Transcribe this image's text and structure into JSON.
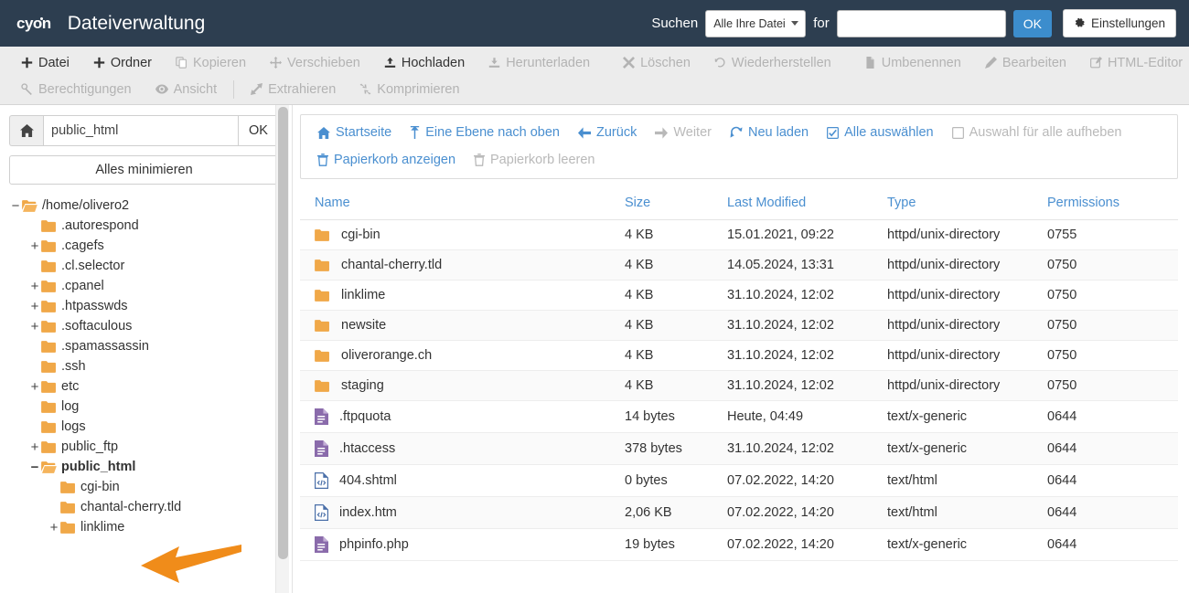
{
  "header": {
    "logo": "cyon",
    "title": "Dateiverwaltung",
    "search_label": "Suchen",
    "search_scope": "Alle Ihre Dateien",
    "for_label": "for",
    "search_value": "",
    "search_placeholder": "",
    "ok_label": "OK",
    "settings_label": "Einstellungen",
    "bg_color": "#2d3e50",
    "accent_color": "#3c8dcd"
  },
  "toolbar": {
    "row1": [
      {
        "label": "Datei",
        "icon": "plus-icon",
        "disabled": false
      },
      {
        "label": "Ordner",
        "icon": "plus-icon",
        "disabled": false
      },
      {
        "label": "Kopieren",
        "icon": "copy-icon",
        "disabled": true
      },
      {
        "label": "Verschieben",
        "icon": "move-icon",
        "disabled": true
      },
      {
        "label": "Hochladen",
        "icon": "upload-icon",
        "disabled": false
      },
      {
        "label": "Herunterladen",
        "icon": "download-icon",
        "disabled": true
      },
      {
        "label": "Löschen",
        "icon": "close-icon",
        "disabled": true
      },
      {
        "label": "Wiederherstellen",
        "icon": "undo-icon",
        "disabled": true
      },
      {
        "label": "Umbenennen",
        "icon": "file-icon",
        "disabled": true
      },
      {
        "label": "Bearbeiten",
        "icon": "pencil-icon",
        "disabled": true
      },
      {
        "label": "HTML-Editor",
        "icon": "html-edit-icon",
        "disabled": true
      }
    ],
    "row2": [
      {
        "label": "Berechtigungen",
        "icon": "key-icon",
        "disabled": true
      },
      {
        "label": "Ansicht",
        "icon": "eye-icon",
        "disabled": true
      },
      {
        "label": "Extrahieren",
        "icon": "expand-icon",
        "disabled": true
      },
      {
        "label": "Komprimieren",
        "icon": "compress-icon",
        "disabled": true
      }
    ]
  },
  "sidebar": {
    "home_icon": "home-icon",
    "path_value": "public_html",
    "path_ok_label": "OK",
    "collapse_all_label": "Alles minimieren",
    "tree": [
      {
        "label": "/home/olivero2",
        "indent": 0,
        "toggle": "−",
        "icon": "folder-open-icon",
        "bold": false
      },
      {
        "label": ".autorespond",
        "indent": 1,
        "toggle": "",
        "icon": "folder-icon",
        "bold": false
      },
      {
        "label": ".cagefs",
        "indent": 1,
        "toggle": "+",
        "icon": "folder-icon",
        "bold": false
      },
      {
        "label": ".cl.selector",
        "indent": 1,
        "toggle": "",
        "icon": "folder-icon",
        "bold": false
      },
      {
        "label": ".cpanel",
        "indent": 1,
        "toggle": "+",
        "icon": "folder-icon",
        "bold": false
      },
      {
        "label": ".htpasswds",
        "indent": 1,
        "toggle": "+",
        "icon": "folder-icon",
        "bold": false
      },
      {
        "label": ".softaculous",
        "indent": 1,
        "toggle": "+",
        "icon": "folder-icon",
        "bold": false
      },
      {
        "label": ".spamassassin",
        "indent": 1,
        "toggle": "",
        "icon": "folder-icon",
        "bold": false
      },
      {
        "label": ".ssh",
        "indent": 1,
        "toggle": "",
        "icon": "folder-icon",
        "bold": false
      },
      {
        "label": "etc",
        "indent": 1,
        "toggle": "+",
        "icon": "folder-icon",
        "bold": false
      },
      {
        "label": "log",
        "indent": 1,
        "toggle": "",
        "icon": "folder-icon",
        "bold": false
      },
      {
        "label": "logs",
        "indent": 1,
        "toggle": "",
        "icon": "folder-icon",
        "bold": false
      },
      {
        "label": "public_ftp",
        "indent": 1,
        "toggle": "+",
        "icon": "folder-icon",
        "bold": false
      },
      {
        "label": "public_html",
        "indent": 1,
        "toggle": "−",
        "icon": "folder-open-icon",
        "bold": true
      },
      {
        "label": "cgi-bin",
        "indent": 2,
        "toggle": "",
        "icon": "folder-icon",
        "bold": false
      },
      {
        "label": "chantal-cherry.tld",
        "indent": 2,
        "toggle": "",
        "icon": "folder-icon",
        "bold": false
      },
      {
        "label": "linklime",
        "indent": 2,
        "toggle": "+",
        "icon": "folder-icon",
        "bold": false
      }
    ]
  },
  "nav": {
    "row1": [
      {
        "label": "Startseite",
        "icon": "home-icon",
        "disabled": false
      },
      {
        "label": "Eine Ebene nach oben",
        "icon": "arrow-up-icon",
        "disabled": false
      },
      {
        "label": "Zurück",
        "icon": "arrow-left-icon",
        "disabled": false
      },
      {
        "label": "Weiter",
        "icon": "arrow-right-icon",
        "disabled": true
      },
      {
        "label": "Neu laden",
        "icon": "reload-icon",
        "disabled": false
      },
      {
        "label": "Alle auswählen",
        "icon": "checkbox-checked-icon",
        "disabled": false
      },
      {
        "label": "Auswahl für alle aufheben",
        "icon": "checkbox-empty-icon",
        "disabled": true
      }
    ],
    "row2": [
      {
        "label": "Papierkorb anzeigen",
        "icon": "trash-icon",
        "disabled": false
      },
      {
        "label": "Papierkorb leeren",
        "icon": "trash-icon",
        "disabled": true
      }
    ]
  },
  "table": {
    "columns": [
      "Name",
      "Size",
      "Last Modified",
      "Type",
      "Permissions"
    ],
    "rows": [
      {
        "name": "cgi-bin",
        "icon": "folder-icon",
        "size": "4 KB",
        "modified": "15.01.2021, 09:22",
        "type": "httpd/unix-directory",
        "permissions": "0755"
      },
      {
        "name": "chantal-cherry.tld",
        "icon": "folder-icon",
        "size": "4 KB",
        "modified": "14.05.2024, 13:31",
        "type": "httpd/unix-directory",
        "permissions": "0750"
      },
      {
        "name": "linklime",
        "icon": "folder-icon",
        "size": "4 KB",
        "modified": "31.10.2024, 12:02",
        "type": "httpd/unix-directory",
        "permissions": "0750"
      },
      {
        "name": "newsite",
        "icon": "folder-icon",
        "size": "4 KB",
        "modified": "31.10.2024, 12:02",
        "type": "httpd/unix-directory",
        "permissions": "0750"
      },
      {
        "name": "oliverorange.ch",
        "icon": "folder-icon",
        "size": "4 KB",
        "modified": "31.10.2024, 12:02",
        "type": "httpd/unix-directory",
        "permissions": "0750"
      },
      {
        "name": "staging",
        "icon": "folder-icon",
        "size": "4 KB",
        "modified": "31.10.2024, 12:02",
        "type": "httpd/unix-directory",
        "permissions": "0750"
      },
      {
        "name": ".ftpquota",
        "icon": "text-file-icon",
        "size": "14 bytes",
        "modified": "Heute, 04:49",
        "type": "text/x-generic",
        "permissions": "0644"
      },
      {
        "name": ".htaccess",
        "icon": "text-file-icon",
        "size": "378 bytes",
        "modified": "31.10.2024, 12:02",
        "type": "text/x-generic",
        "permissions": "0644"
      },
      {
        "name": "404.shtml",
        "icon": "html-file-icon",
        "size": "0 bytes",
        "modified": "07.02.2022, 14:20",
        "type": "text/html",
        "permissions": "0644"
      },
      {
        "name": "index.htm",
        "icon": "html-file-icon",
        "size": "2,06 KB",
        "modified": "07.02.2022, 14:20",
        "type": "text/html",
        "permissions": "0644"
      },
      {
        "name": "phpinfo.php",
        "icon": "text-file-icon",
        "size": "19 bytes",
        "modified": "07.02.2022, 14:20",
        "type": "text/x-generic",
        "permissions": "0644"
      }
    ]
  },
  "annotation": {
    "arrow_icon": "arrow-left-annotation-icon",
    "arrow_color": "#f08c1a"
  }
}
